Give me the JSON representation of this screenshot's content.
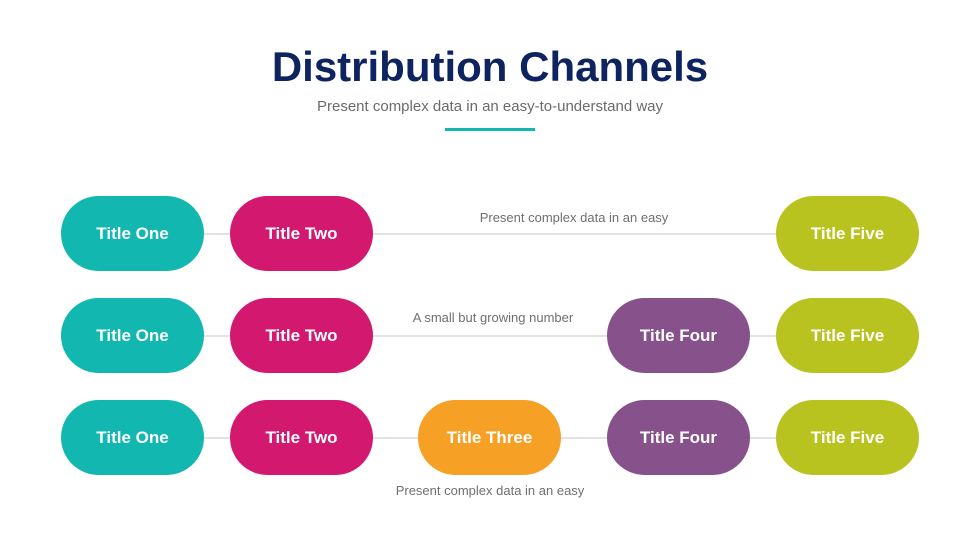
{
  "header": {
    "title": "Distribution Channels",
    "subtitle": "Present complex data in an easy-to-understand way",
    "accent_color": "#12b8b0",
    "title_color": "#0e2461"
  },
  "colors": {
    "one": "#12b8b0",
    "two": "#d3186f",
    "three": "#f6a025",
    "four": "#87528c",
    "five": "#b8c31f",
    "connector": "#e3e3e3"
  },
  "rows": [
    {
      "pills": [
        {
          "label": "Title One",
          "color_key": "one"
        },
        {
          "label": "Title Two",
          "color_key": "two"
        },
        {
          "label": "Title Five",
          "color_key": "five"
        }
      ],
      "note": "Present complex data in an easy"
    },
    {
      "pills": [
        {
          "label": "Title One",
          "color_key": "one"
        },
        {
          "label": "Title Two",
          "color_key": "two"
        },
        {
          "label": "Title Four",
          "color_key": "four"
        },
        {
          "label": "Title Five",
          "color_key": "five"
        }
      ],
      "note": "A small but growing number"
    },
    {
      "pills": [
        {
          "label": "Title One",
          "color_key": "one"
        },
        {
          "label": "Title Two",
          "color_key": "two"
        },
        {
          "label": "Title Three",
          "color_key": "three"
        },
        {
          "label": "Title Four",
          "color_key": "four"
        },
        {
          "label": "Title Five",
          "color_key": "five"
        }
      ],
      "note": "Present complex data in an easy"
    }
  ]
}
